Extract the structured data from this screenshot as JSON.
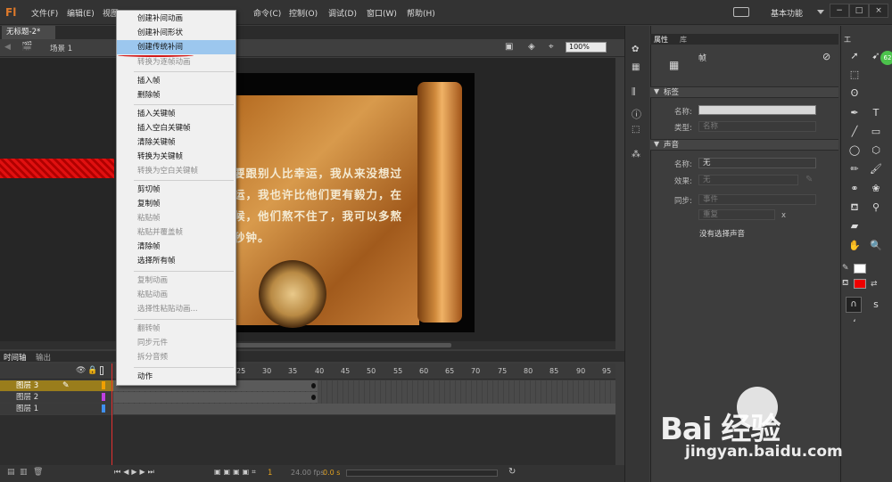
{
  "app": {
    "logo": "Fl",
    "workspace": "基本功能"
  },
  "menus": [
    "文件(F)",
    "编辑(E)",
    "视图",
    "命令(C)",
    "控制(O)",
    "调试(D)",
    "窗口(W)",
    "帮助(H)"
  ],
  "window_buttons": [
    "−",
    "□",
    "×"
  ],
  "document": {
    "tab": "无标题-2*",
    "scene": "场景 1",
    "zoom": "100%"
  },
  "context_menu": {
    "items": [
      {
        "label": "创建补间动画",
        "state": "normal"
      },
      {
        "label": "创建补间形状",
        "state": "normal"
      },
      {
        "label": "创建传统补间",
        "state": "selected"
      },
      {
        "label": "转换为逐帧动画",
        "state": "disabled"
      },
      {
        "label": "插入帧",
        "state": "normal"
      },
      {
        "label": "删除帧",
        "state": "normal"
      },
      {
        "label": "插入关键帧",
        "state": "normal"
      },
      {
        "label": "插入空白关键帧",
        "state": "normal"
      },
      {
        "label": "清除关键帧",
        "state": "normal"
      },
      {
        "label": "转换为关键帧",
        "state": "normal"
      },
      {
        "label": "转换为空白关键帧",
        "state": "disabled"
      },
      {
        "label": "剪切帧",
        "state": "normal"
      },
      {
        "label": "复制帧",
        "state": "normal"
      },
      {
        "label": "粘贴帧",
        "state": "disabled"
      },
      {
        "label": "粘贴并覆盖帧",
        "state": "disabled"
      },
      {
        "label": "清除帧",
        "state": "normal"
      },
      {
        "label": "选择所有帧",
        "state": "normal"
      },
      {
        "label": "复制动画",
        "state": "disabled"
      },
      {
        "label": "粘贴动画",
        "state": "disabled"
      },
      {
        "label": "选择性粘贴动画...",
        "state": "disabled"
      },
      {
        "label": "翻转帧",
        "state": "disabled"
      },
      {
        "label": "同步元件",
        "state": "disabled"
      },
      {
        "label": "拆分音频",
        "state": "disabled"
      },
      {
        "label": "动作",
        "state": "normal"
      }
    ]
  },
  "stage_text": [
    "要跟别人比幸运，我从来没想过",
    "运，我也许比他们更有毅力，在",
    "候，他们熬不住了，我可以多熬",
    "秒钟。"
  ],
  "timeline": {
    "tabs": [
      "时间轴",
      "输出"
    ],
    "ruler": [
      "25",
      "30",
      "35",
      "40",
      "45",
      "50",
      "55",
      "60",
      "65",
      "70",
      "75",
      "80",
      "85",
      "90",
      "95"
    ],
    "layers": [
      "图层 3",
      "图层 2",
      "图层 1"
    ],
    "frame_number": "1",
    "fps": "24.00 fps",
    "time": "0.0 s"
  },
  "properties": {
    "tabs": [
      "属性",
      "库"
    ],
    "title": "帧",
    "label_section": "标签",
    "name_label": "名称:",
    "type_label": "类型:",
    "type_value": "名称",
    "sound_section": "声音",
    "sound_name_value": "无",
    "effect_label": "效果:",
    "effect_value": "无",
    "sync_label": "同步:",
    "sync_value": "事件",
    "repeat_value": "重复",
    "repeat_times": "x",
    "no_sound": "没有选择声音"
  },
  "tools": {
    "panel_title": "工",
    "badge": "62"
  },
  "watermark": {
    "logo": "Bai  经验",
    "url": "jingyan.baidu.com"
  },
  "colors": {
    "accent_selection": "#9cc7ee",
    "layer_selected": "#9a7d1c",
    "stage_red": "#e01010",
    "fill_color": "#ee0000",
    "stroke_color": "#ffffff"
  }
}
